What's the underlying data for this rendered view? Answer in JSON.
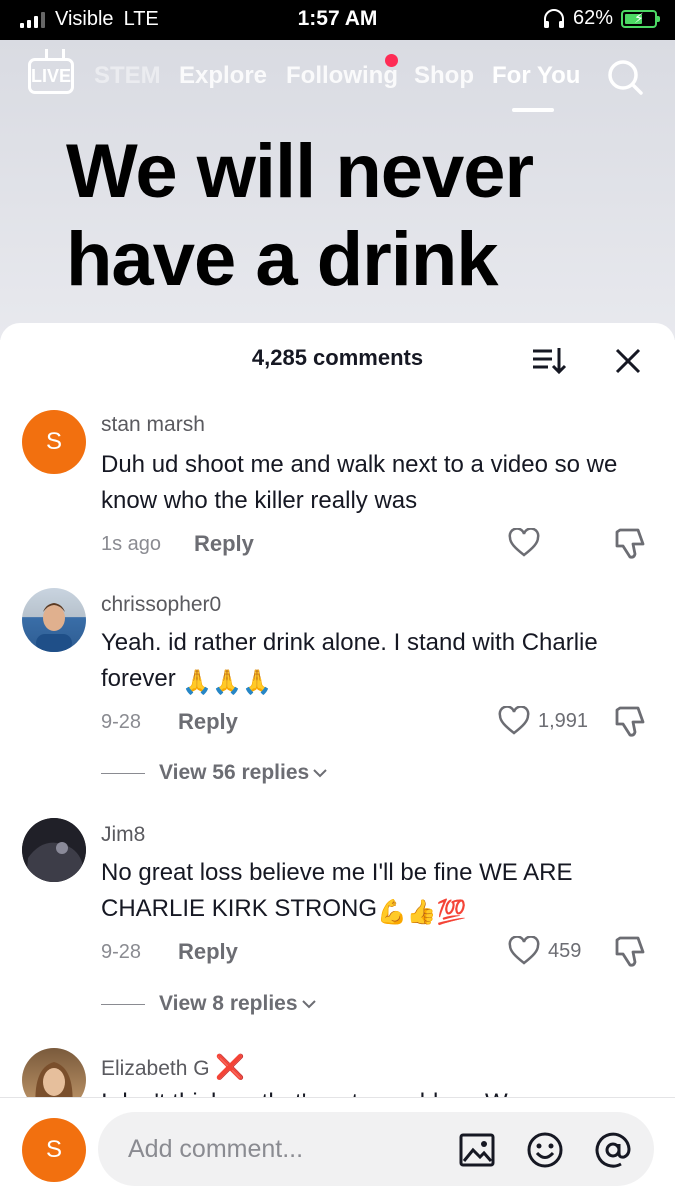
{
  "status_bar": {
    "carrier": "Visible",
    "network": "LTE",
    "time": "1:57 AM",
    "battery_percent": "62%",
    "battery_level": 0.62
  },
  "top_nav": {
    "live_label": "LIVE",
    "tabs": [
      {
        "label": "STEM",
        "faded": true
      },
      {
        "label": "Explore"
      },
      {
        "label": "Following",
        "has_notification": true
      },
      {
        "label": "Shop"
      },
      {
        "label": "For You",
        "active": true
      }
    ]
  },
  "video": {
    "caption_line1": "We will never",
    "caption_line2": "have a drink"
  },
  "comments_sheet": {
    "count_label": "4,285 comments",
    "comments": [
      {
        "avatar_letter": "S",
        "username": "stan marsh",
        "text": "Duh ud shoot me and walk next to a video so we know who the killer really was",
        "date": "1s ago",
        "reply_label": "Reply",
        "likes": ""
      },
      {
        "username": "chrissopher0",
        "text": "Yeah. id rather drink alone. I stand with Charlie forever",
        "emojis": "🙏🙏🙏",
        "date": "9-28",
        "reply_label": "Reply",
        "likes": "1,991",
        "view_replies": "View 56 replies"
      },
      {
        "username": "Jim8",
        "text": "No great loss believe me I'll be fine WE ARE CHARLIE KIRK STRONG",
        "emojis": "💪👍💯",
        "date": "9-28",
        "reply_label": "Reply",
        "likes": "459",
        "view_replies": "View 8 replies"
      },
      {
        "username": "Elizabeth G",
        "badge": "❌",
        "text": "I don't think so that's not a problem. We"
      }
    ]
  },
  "bottom_bar": {
    "avatar_letter": "S",
    "input_placeholder": "Add comment..."
  },
  "colors": {
    "accent_red": "#fe2c55",
    "avatar_orange": "#f2700f",
    "battery_green": "#4cd964"
  }
}
